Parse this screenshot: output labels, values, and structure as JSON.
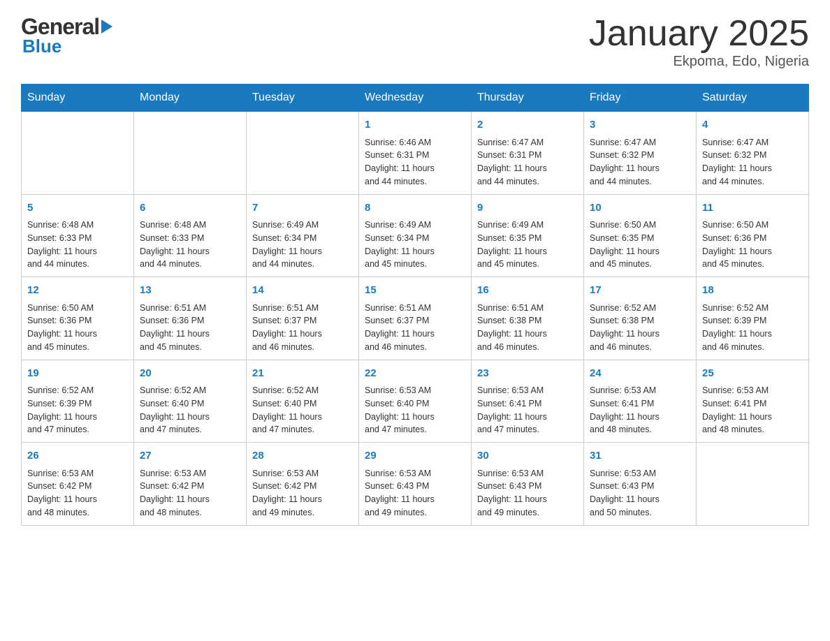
{
  "header": {
    "logo_general": "General",
    "logo_blue": "Blue",
    "month_title": "January 2025",
    "location": "Ekpoma, Edo, Nigeria"
  },
  "weekdays": [
    "Sunday",
    "Monday",
    "Tuesday",
    "Wednesday",
    "Thursday",
    "Friday",
    "Saturday"
  ],
  "weeks": [
    [
      {
        "day": "",
        "info": ""
      },
      {
        "day": "",
        "info": ""
      },
      {
        "day": "",
        "info": ""
      },
      {
        "day": "1",
        "info": "Sunrise: 6:46 AM\nSunset: 6:31 PM\nDaylight: 11 hours\nand 44 minutes."
      },
      {
        "day": "2",
        "info": "Sunrise: 6:47 AM\nSunset: 6:31 PM\nDaylight: 11 hours\nand 44 minutes."
      },
      {
        "day": "3",
        "info": "Sunrise: 6:47 AM\nSunset: 6:32 PM\nDaylight: 11 hours\nand 44 minutes."
      },
      {
        "day": "4",
        "info": "Sunrise: 6:47 AM\nSunset: 6:32 PM\nDaylight: 11 hours\nand 44 minutes."
      }
    ],
    [
      {
        "day": "5",
        "info": "Sunrise: 6:48 AM\nSunset: 6:33 PM\nDaylight: 11 hours\nand 44 minutes."
      },
      {
        "day": "6",
        "info": "Sunrise: 6:48 AM\nSunset: 6:33 PM\nDaylight: 11 hours\nand 44 minutes."
      },
      {
        "day": "7",
        "info": "Sunrise: 6:49 AM\nSunset: 6:34 PM\nDaylight: 11 hours\nand 44 minutes."
      },
      {
        "day": "8",
        "info": "Sunrise: 6:49 AM\nSunset: 6:34 PM\nDaylight: 11 hours\nand 45 minutes."
      },
      {
        "day": "9",
        "info": "Sunrise: 6:49 AM\nSunset: 6:35 PM\nDaylight: 11 hours\nand 45 minutes."
      },
      {
        "day": "10",
        "info": "Sunrise: 6:50 AM\nSunset: 6:35 PM\nDaylight: 11 hours\nand 45 minutes."
      },
      {
        "day": "11",
        "info": "Sunrise: 6:50 AM\nSunset: 6:36 PM\nDaylight: 11 hours\nand 45 minutes."
      }
    ],
    [
      {
        "day": "12",
        "info": "Sunrise: 6:50 AM\nSunset: 6:36 PM\nDaylight: 11 hours\nand 45 minutes."
      },
      {
        "day": "13",
        "info": "Sunrise: 6:51 AM\nSunset: 6:36 PM\nDaylight: 11 hours\nand 45 minutes."
      },
      {
        "day": "14",
        "info": "Sunrise: 6:51 AM\nSunset: 6:37 PM\nDaylight: 11 hours\nand 46 minutes."
      },
      {
        "day": "15",
        "info": "Sunrise: 6:51 AM\nSunset: 6:37 PM\nDaylight: 11 hours\nand 46 minutes."
      },
      {
        "day": "16",
        "info": "Sunrise: 6:51 AM\nSunset: 6:38 PM\nDaylight: 11 hours\nand 46 minutes."
      },
      {
        "day": "17",
        "info": "Sunrise: 6:52 AM\nSunset: 6:38 PM\nDaylight: 11 hours\nand 46 minutes."
      },
      {
        "day": "18",
        "info": "Sunrise: 6:52 AM\nSunset: 6:39 PM\nDaylight: 11 hours\nand 46 minutes."
      }
    ],
    [
      {
        "day": "19",
        "info": "Sunrise: 6:52 AM\nSunset: 6:39 PM\nDaylight: 11 hours\nand 47 minutes."
      },
      {
        "day": "20",
        "info": "Sunrise: 6:52 AM\nSunset: 6:40 PM\nDaylight: 11 hours\nand 47 minutes."
      },
      {
        "day": "21",
        "info": "Sunrise: 6:52 AM\nSunset: 6:40 PM\nDaylight: 11 hours\nand 47 minutes."
      },
      {
        "day": "22",
        "info": "Sunrise: 6:53 AM\nSunset: 6:40 PM\nDaylight: 11 hours\nand 47 minutes."
      },
      {
        "day": "23",
        "info": "Sunrise: 6:53 AM\nSunset: 6:41 PM\nDaylight: 11 hours\nand 47 minutes."
      },
      {
        "day": "24",
        "info": "Sunrise: 6:53 AM\nSunset: 6:41 PM\nDaylight: 11 hours\nand 48 minutes."
      },
      {
        "day": "25",
        "info": "Sunrise: 6:53 AM\nSunset: 6:41 PM\nDaylight: 11 hours\nand 48 minutes."
      }
    ],
    [
      {
        "day": "26",
        "info": "Sunrise: 6:53 AM\nSunset: 6:42 PM\nDaylight: 11 hours\nand 48 minutes."
      },
      {
        "day": "27",
        "info": "Sunrise: 6:53 AM\nSunset: 6:42 PM\nDaylight: 11 hours\nand 48 minutes."
      },
      {
        "day": "28",
        "info": "Sunrise: 6:53 AM\nSunset: 6:42 PM\nDaylight: 11 hours\nand 49 minutes."
      },
      {
        "day": "29",
        "info": "Sunrise: 6:53 AM\nSunset: 6:43 PM\nDaylight: 11 hours\nand 49 minutes."
      },
      {
        "day": "30",
        "info": "Sunrise: 6:53 AM\nSunset: 6:43 PM\nDaylight: 11 hours\nand 49 minutes."
      },
      {
        "day": "31",
        "info": "Sunrise: 6:53 AM\nSunset: 6:43 PM\nDaylight: 11 hours\nand 50 minutes."
      },
      {
        "day": "",
        "info": ""
      }
    ]
  ]
}
